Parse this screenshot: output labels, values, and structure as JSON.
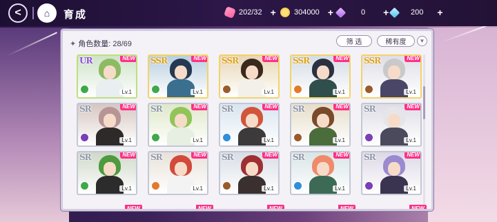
{
  "header": {
    "back_label": "<",
    "home_label": "⌂",
    "title": "育成",
    "resources": [
      {
        "name": "candy",
        "value": "202/32",
        "plus": "+"
      },
      {
        "name": "coin",
        "value": "304000",
        "plus": "+"
      },
      {
        "name": "purple-gem",
        "value": "0",
        "plus": "+"
      },
      {
        "name": "blue-gem",
        "value": "200",
        "plus": "+"
      }
    ]
  },
  "panel": {
    "count_label": "角色数量: 28/69",
    "filter_label": "筛 选",
    "rarity_label": "稀有度",
    "sort_icon": "▼"
  },
  "cards": [
    {
      "rarity": "UR",
      "tag": "NEW",
      "level": "Lv.1",
      "attr_color": "#3fa84a",
      "bg": "#cfe3c9",
      "hair": "#8dbb63",
      "outfit": "#e9eef0"
    },
    {
      "rarity": "SSR",
      "tag": "NEW",
      "level": "Lv.1",
      "attr_color": "#3fa84a",
      "bg": "#b9cfe0",
      "hair": "#263852",
      "outfit": "#3a6f8f"
    },
    {
      "rarity": "SSR",
      "tag": "NEW",
      "level": "Lv.1",
      "attr_color": "#9a5b2b",
      "bg": "#e8d6b4",
      "hair": "#3a2a1e",
      "outfit": "#f3f0ea"
    },
    {
      "rarity": "SSR",
      "tag": "NEW",
      "level": "Lv.1",
      "attr_color": "#e27a2b",
      "bg": "#d5dce5",
      "hair": "#2b3140",
      "outfit": "#2f4e4c"
    },
    {
      "rarity": "SSR",
      "tag": "NEW",
      "level": "Lv.1",
      "attr_color": "#9a5b2b",
      "bg": "#dfdde7",
      "hair": "#c9c9c9",
      "outfit": "#4a4668"
    },
    {
      "rarity": "SR",
      "tag": "NEW",
      "level": "Lv.1",
      "attr_color": "#7a3fb6",
      "bg": "#d6c7c2",
      "hair": "#b89595",
      "outfit": "#2f2a2a"
    },
    {
      "rarity": "SR",
      "tag": "NEW",
      "level": "Lv.1",
      "attr_color": "#3fa84a",
      "bg": "#dfe8c9",
      "hair": "#92c45a",
      "outfit": "#e6efe1"
    },
    {
      "rarity": "SR",
      "tag": "NEW",
      "level": "Lv.1",
      "attr_color": "#2f8fd8",
      "bg": "#d8e4ef",
      "hair": "#d2553a",
      "outfit": "#3c3a3a"
    },
    {
      "rarity": "SR",
      "tag": "NEW",
      "level": "Lv.1",
      "attr_color": "#9a5b2b",
      "bg": "#e6ddc9",
      "hair": "#7a4a2a",
      "outfit": "#4b6c3b"
    },
    {
      "rarity": "SR",
      "tag": "NEW",
      "level": "Lv.1",
      "attr_color": "#7a3fb6",
      "bg": "#dfdde6",
      "hair": "#e6e6ea",
      "outfit": "#4a4a5c"
    },
    {
      "rarity": "SR",
      "tag": "NEW",
      "level": "Lv.1",
      "attr_color": "#3fa84a",
      "bg": "#cfd8c9",
      "hair": "#4e9a3e",
      "outfit": "#2c2c2c"
    },
    {
      "rarity": "SR",
      "tag": "NEW",
      "level": "Lv.1",
      "attr_color": "#e27a2b",
      "bg": "#e8e1d9",
      "hair": "#d24a3a",
      "outfit": "#f3f3f3"
    },
    {
      "rarity": "SR",
      "tag": "NEW",
      "level": "Lv.1",
      "attr_color": "#9a5b2b",
      "bg": "#d8dde5",
      "hair": "#9e2f32",
      "outfit": "#3a3030"
    },
    {
      "rarity": "SR",
      "tag": "NEW",
      "level": "Lv.1",
      "attr_color": "#2f8fd8",
      "bg": "#d8e4e6",
      "hair": "#f08a6a",
      "outfit": "#3d6a55"
    },
    {
      "rarity": "SR",
      "tag": "NEW",
      "level": "Lv.1",
      "attr_color": "#7a3fb6",
      "bg": "#ddd8e6",
      "hair": "#9a8ad0",
      "outfit": "#3a3450"
    }
  ],
  "peek_tags": [
    "NEW",
    "NEW",
    "NEW",
    "NEW",
    "NEW"
  ]
}
